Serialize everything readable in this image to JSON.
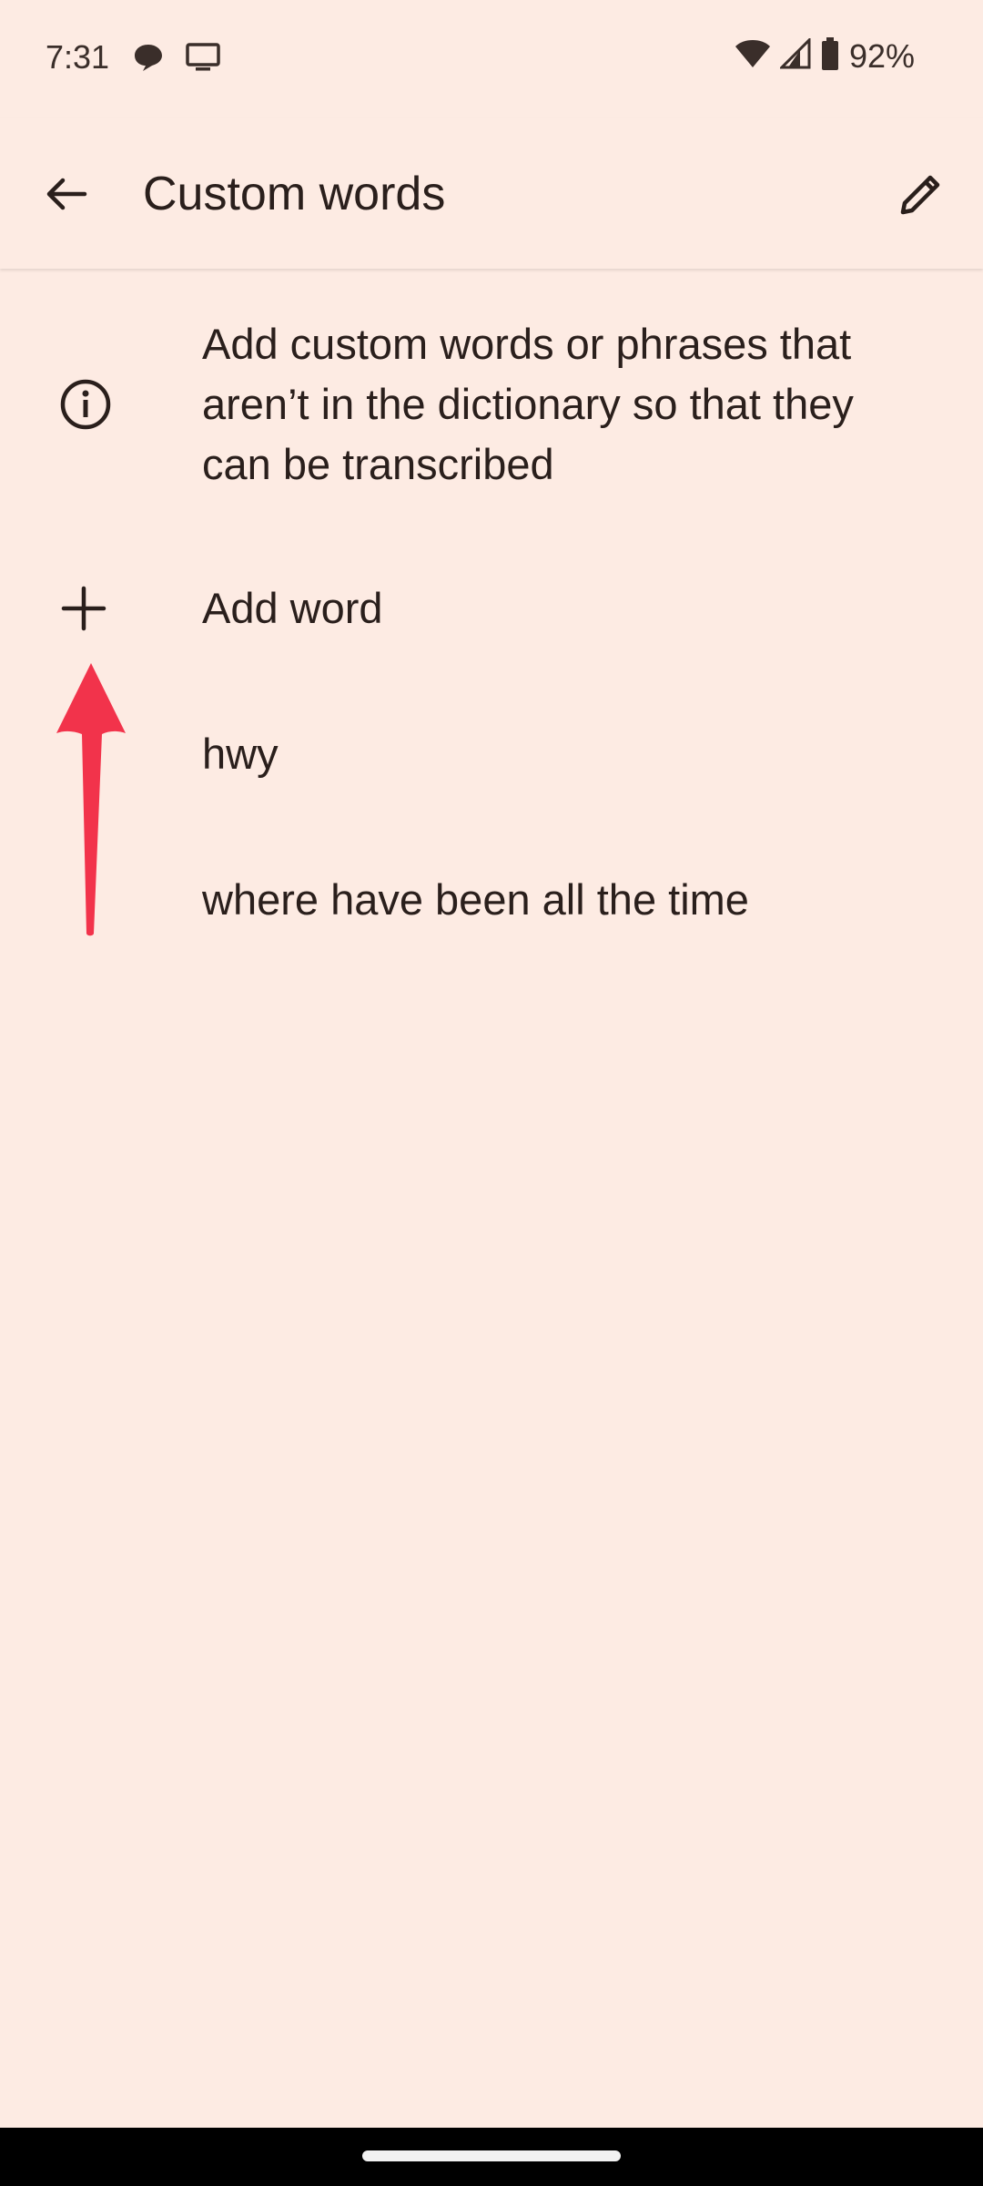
{
  "status_bar": {
    "time": "7:31",
    "battery_percent": "92%",
    "icons": [
      "chat-bubble-icon",
      "cast-screen-icon",
      "wifi-icon",
      "signal-icon",
      "battery-icon"
    ]
  },
  "app_bar": {
    "title": "Custom words",
    "back_icon": "arrow-back-icon",
    "edit_icon": "pencil-icon"
  },
  "info": {
    "icon": "info-icon",
    "text": "Add custom words or phrases that aren’t in the dictionary so that they can be transcribed"
  },
  "add_word": {
    "icon": "plus-icon",
    "label": "Add word"
  },
  "words": [
    "hwy",
    "where have been all the time"
  ],
  "colors": {
    "background": "#fdebe3",
    "text": "#2a1f1c",
    "annotation_arrow": "#f2334b",
    "nav_bar": "#000000"
  }
}
